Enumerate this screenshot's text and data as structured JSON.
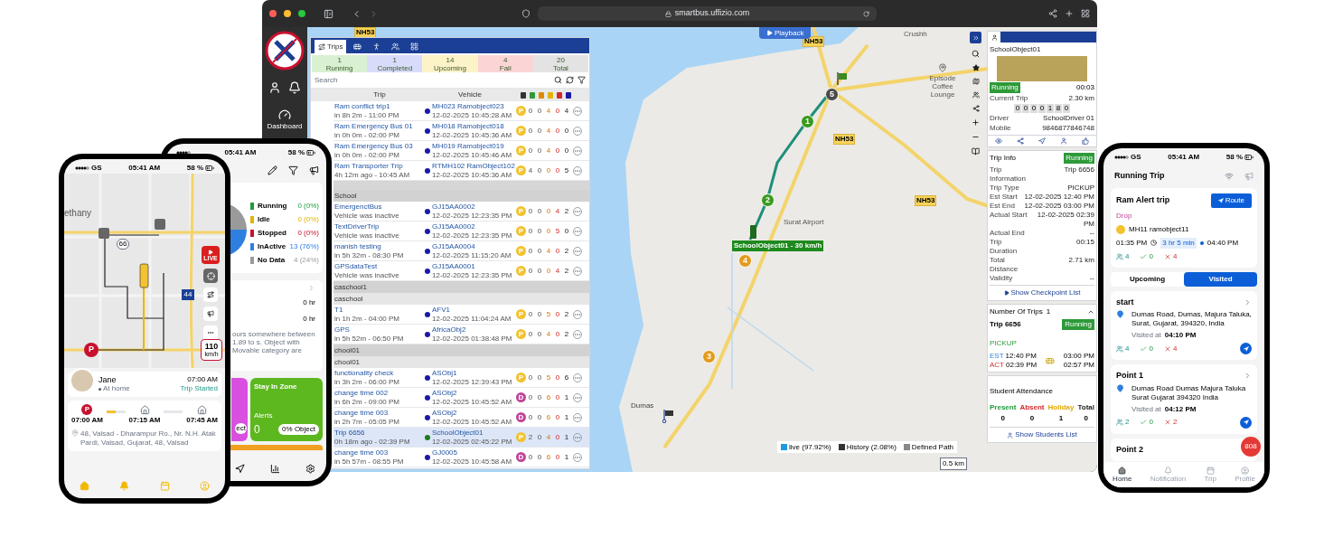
{
  "browser": {
    "url": "smartbus.uffizio.com",
    "sidebar": {
      "dashboard": "Dashboard"
    },
    "trips_panel": {
      "tabs": [
        {
          "label": "Trips",
          "selected": true
        },
        {
          "selected": false
        },
        {
          "selected": false
        },
        {
          "selected": false
        },
        {
          "selected": false
        }
      ],
      "summary": [
        {
          "count": "1",
          "label": "Running",
          "color": "#d9f0d3"
        },
        {
          "count": "1",
          "label": "Completed",
          "color": "#d8dcfa"
        },
        {
          "count": "14",
          "label": "Upcoming",
          "color": "#fdf3c8"
        },
        {
          "count": "4",
          "label": "Fail",
          "color": "#fbd5d5"
        },
        {
          "count": "20",
          "label": "Total",
          "color": "#e3e3e3"
        }
      ],
      "search": {
        "placeholder": "Search"
      },
      "columns": [
        "Trip",
        "Vehicle"
      ],
      "rows": [
        {
          "kind": "trip",
          "name": "Ram conflict trip1",
          "eta": "in 8h 2m - 11:00 PM",
          "vehicle": "MH023 Ramobject023",
          "time": "12-02-2025 10:45:28 AM",
          "dot": {
            "color": "#1a1aa6"
          },
          "badge": {
            "label": "P",
            "color": "#f2c230"
          },
          "counts": [
            "0",
            "0",
            "4",
            "0",
            "4"
          ],
          "selected": false
        },
        {
          "kind": "trip",
          "name": "Ram Emergency Bus 01",
          "eta": "in 0h 0m - 02:00 PM",
          "vehicle": "MH018 Ramobject018",
          "time": "12-02-2025 10:45:36 AM",
          "dot": {
            "color": "#1a1aa6"
          },
          "badge": {
            "label": "P",
            "color": "#f2c230"
          },
          "counts": [
            "0",
            "0",
            "4",
            "0",
            "0"
          ],
          "selected": false
        },
        {
          "kind": "trip",
          "name": "Ram Emergency Bus 03",
          "eta": "in 0h 0m - 02:00 PM",
          "vehicle": "MH019 Ramobject019",
          "time": "12-02-2025 10:45:46 AM",
          "dot": {
            "color": "#1a1aa6"
          },
          "badge": {
            "label": "P",
            "color": "#f2c230"
          },
          "counts": [
            "0",
            "0",
            "4",
            "0",
            "0"
          ],
          "selected": false
        },
        {
          "kind": "trip",
          "name": "Ram Transporter Trip",
          "eta": "4h 12m ago - 10:45 AM",
          "vehicle": "RTMH102 RamObject102",
          "time": "12-02-2025 10:45:36 AM",
          "dot": {
            "color": "#1a1aa6"
          },
          "badge": {
            "label": "P",
            "color": "#f2c230"
          },
          "counts": [
            "4",
            "0",
            "0",
            "0",
            "5"
          ],
          "selected": false
        },
        {
          "kind": "spacer"
        },
        {
          "kind": "group",
          "label": "School"
        },
        {
          "kind": "trip",
          "name": "EmergenctBus",
          "eta": "Vehicle was inactive",
          "vehicle": "GJ15AA0002",
          "time": "12-02-2025 12:23:35 PM",
          "dot": {
            "color": "#1a1aa6"
          },
          "badge": {
            "label": "P",
            "color": "#f2c230"
          },
          "counts": [
            "0",
            "0",
            "0",
            "4",
            "2"
          ],
          "selected": false
        },
        {
          "kind": "trip",
          "name": "TextDriverTrip",
          "eta": "Vehicle was inactive",
          "vehicle": "GJ15AA0002",
          "time": "12-02-2025 12:23:35 PM",
          "dot": {
            "color": "#1a1aa6"
          },
          "badge": {
            "label": "P",
            "color": "#f2c230"
          },
          "counts": [
            "0",
            "0",
            "0",
            "5",
            "0"
          ],
          "selected": false
        },
        {
          "kind": "trip",
          "name": "manish testing",
          "eta": "in 5h 32m - 08:30 PM",
          "vehicle": "GJ15AA0004",
          "time": "12-02-2025 11:15:20 AM",
          "dot": {
            "color": "#1a1aa6"
          },
          "badge": {
            "label": "P",
            "color": "#f2c230"
          },
          "counts": [
            "0",
            "0",
            "4",
            "0",
            "2"
          ],
          "selected": false
        },
        {
          "kind": "trip",
          "name": "GPSdataTest",
          "eta": "Vehicle was inactive",
          "vehicle": "GJ15AA0001",
          "time": "12-02-2025 12:23:35 PM",
          "dot": {
            "color": "#1a1aa6"
          },
          "badge": {
            "label": "P",
            "color": "#f2c230"
          },
          "counts": [
            "0",
            "0",
            "0",
            "4",
            "2"
          ],
          "selected": false
        },
        {
          "kind": "group",
          "label": "caschool1"
        },
        {
          "kind": "subgroup",
          "label": "caschool"
        },
        {
          "kind": "trip",
          "name": "T1",
          "eta": "in 1h 2m - 04:00 PM",
          "vehicle": "AFV1",
          "time": "12-02-2025 11:04:24 AM",
          "dot": {
            "color": "#1a1aa6"
          },
          "badge": {
            "label": "P",
            "color": "#f2c230"
          },
          "counts": [
            "0",
            "0",
            "5",
            "0",
            "2"
          ],
          "selected": false
        },
        {
          "kind": "trip",
          "name": "GPS",
          "eta": "in 5h 52m - 06:50 PM",
          "vehicle": "AfricaObj2",
          "time": "12-02-2025 01:38:48 PM",
          "dot": {
            "color": "#1a1aa6"
          },
          "badge": {
            "label": "P",
            "color": "#f2c230"
          },
          "counts": [
            "0",
            "0",
            "4",
            "0",
            "2"
          ],
          "selected": false
        },
        {
          "kind": "group",
          "label": "chool01"
        },
        {
          "kind": "subgroup",
          "label": "chool01"
        },
        {
          "kind": "trip",
          "name": "functionality check",
          "eta": "in 3h 2m - 06:00 PM",
          "vehicle": "ASObj1",
          "time": "12-02-2025 12:39:43 PM",
          "dot": {
            "color": "#1a1aa6"
          },
          "badge": {
            "label": "P",
            "color": "#f2c230"
          },
          "counts": [
            "0",
            "0",
            "5",
            "0",
            "6"
          ],
          "selected": false
        },
        {
          "kind": "trip",
          "name": "change time 002",
          "eta": "in 6h 2m - 09:00 PM",
          "vehicle": "ASObj2",
          "time": "12-02-2025 10:45:52 AM",
          "dot": {
            "color": "#1a1aa6"
          },
          "badge": {
            "label": "D",
            "color": "#c2469a"
          },
          "counts": [
            "0",
            "0",
            "6",
            "0",
            "1"
          ],
          "selected": false
        },
        {
          "kind": "trip",
          "name": "change time 003",
          "eta": "in 2h 7m - 05:05 PM",
          "vehicle": "ASObj2",
          "time": "12-02-2025 10:45:52 AM",
          "dot": {
            "color": "#1a1aa6"
          },
          "badge": {
            "label": "D",
            "color": "#c2469a"
          },
          "counts": [
            "0",
            "0",
            "6",
            "0",
            "1"
          ],
          "selected": false
        },
        {
          "kind": "trip",
          "name": "Trip 6656",
          "eta": "0h 18m ago - 02:39 PM",
          "vehicle": "SchoolObject01",
          "time": "12-02-2025 02:45:22 PM",
          "dot": {
            "color": "#1e7d1e"
          },
          "badge": {
            "label": "P",
            "color": "#f2c230"
          },
          "counts": [
            "2",
            "0",
            "4",
            "0",
            "1"
          ],
          "selected": true
        },
        {
          "kind": "trip",
          "name": "change time 003",
          "eta": "in 5h 57m - 08:55 PM",
          "vehicle": "GJ0005",
          "time": "12-02-2025 10:45:58 AM",
          "dot": {
            "color": "#1a1aa6"
          },
          "badge": {
            "label": "D",
            "color": "#c2469a"
          },
          "counts": [
            "0",
            "0",
            "6",
            "0",
            "1"
          ],
          "selected": false
        }
      ]
    },
    "map": {
      "playback": "Playback",
      "roads": [
        "NH53",
        "NH53",
        "NH53",
        "NH53"
      ],
      "places": [
        "Crushh",
        "Episode Coffee Lounge",
        "Surat Airport",
        "Dumas"
      ],
      "stops": [
        {
          "label": "5",
          "color": "#4a4a4a"
        },
        {
          "label": "1",
          "color": "#3a9a1e"
        },
        {
          "label": "2",
          "color": "#3a9a1e"
        },
        {
          "label": "4",
          "color": "#e39a1c"
        },
        {
          "label": "3",
          "color": "#e39a1c"
        }
      ],
      "vehicle_label": "SchoolObject01 - 30 km/h",
      "legend": [
        {
          "label": "live (97.92%)",
          "color": "#1e9be0"
        },
        {
          "label": "History (2.08%)",
          "color": "#333333"
        },
        {
          "label": "Defined Path",
          "color": "#888888"
        }
      ],
      "scale": "0.5 km"
    },
    "object_panel": {
      "name": "SchoolObject01",
      "status": "Running",
      "duration": "00:03",
      "current_trip_label": "Current Trip",
      "current_trip": "2.30 km",
      "odometer": [
        "0",
        "0",
        "0",
        "0",
        "1",
        "8",
        "0"
      ],
      "fields": [
        {
          "label": "Driver",
          "value": "SchoolDriver 01"
        },
        {
          "label": "Mobile",
          "value": "9846877846748"
        }
      ]
    },
    "trip_info": {
      "title": "Trip Info",
      "status": "Running",
      "fields": [
        {
          "label": "Trip Information",
          "value": "Trip 6656"
        },
        {
          "label": "Trip Type",
          "value": "PICKUP"
        },
        {
          "label": "Est Start",
          "value": "12-02-2025 12:40 PM"
        },
        {
          "label": "Est End",
          "value": "12-02-2025 03:00 PM"
        },
        {
          "label": "Actual Start",
          "value": "12-02-2025 02:39 PM"
        },
        {
          "label": "Actual End",
          "value": "--"
        },
        {
          "label": "Trip Duration",
          "value": "00:15"
        },
        {
          "label": "Total Distance",
          "value": "2.71 km"
        },
        {
          "label": "Validity",
          "value": "--"
        }
      ],
      "action": "Show Checkpoint List"
    },
    "trips_count": {
      "title": "Number Of Trips",
      "count": "1",
      "trip": "Trip 6656",
      "type": "PICKUP",
      "status": "Running",
      "est_label": "EST",
      "est_start": "12:40 PM",
      "est_end": "03:00 PM",
      "act_label": "ACT",
      "act_start": "02:39 PM",
      "act_end": "02:57 PM"
    },
    "attendance": {
      "title": "Student Attendance",
      "items": [
        {
          "label": "Present",
          "value": "0",
          "color": "#1e9a3a"
        },
        {
          "label": "Absent",
          "value": "0",
          "color": "#d02a2a"
        },
        {
          "label": "Holiday",
          "value": "1",
          "color": "#e0a800"
        },
        {
          "label": "Total",
          "value": "0",
          "color": "#222222"
        }
      ],
      "action": "Show Students List"
    }
  },
  "dashboard_phone": {
    "time": "05:41 AM",
    "battery": "58 %",
    "legend": [
      {
        "label": "Running",
        "value": "0 (0%)",
        "color": "#1e9a3a"
      },
      {
        "label": "Idle",
        "value": "0 (0%)",
        "color": "#e0b400"
      },
      {
        "label": "Stopped",
        "value": "0 (0%)",
        "color": "#c8102e"
      },
      {
        "label": "InActive",
        "value": "13 (76%)",
        "color": "#2f7fe0"
      },
      {
        "label": "No Data",
        "value": "4 (24%)",
        "color": "#9a9a9a"
      }
    ],
    "hours": [
      "0 hr",
      "0 hr"
    ],
    "note_lines": [
      "ours somewhere between 1.89 to",
      "s. Object with Movable category are"
    ],
    "tiles": [
      {
        "kind": "pink",
        "button": "ect"
      },
      {
        "kind": "green",
        "title": "Stay In Zone",
        "caption": "Alerts",
        "value": "0",
        "button": "0% Object"
      }
    ]
  },
  "parent_phone": {
    "carrier": "GS",
    "parking": "P",
    "time": "05:41 AM",
    "battery": "58 %",
    "place": "ethany",
    "shields": [
      "66",
      "44"
    ],
    "live": "LIVE",
    "speed": "110",
    "speed_unit": "km/h",
    "child": {
      "name": "Jane",
      "status": "At home",
      "time": "07:00 AM",
      "trip_status": "Trip Started"
    },
    "timeline": [
      {
        "marker": "P",
        "time": "07:00 AM",
        "level": 0.5
      },
      {
        "time": "07:15 AM",
        "level": 0
      },
      {
        "time": "07:45 AM"
      }
    ],
    "address": "48, Valsad - Dharampur Ro., Nr. N.H. Atak Pardi, Valsad, Gujarat, 48, Valsad"
  },
  "driver_phone": {
    "carrier": "GS",
    "time": "05:41 AM",
    "battery": "58 %",
    "title": "Running Trip",
    "trip": {
      "name": "Route",
      "title": "Ram Alert trip",
      "type": "Drop",
      "vehicle": "MH11 ramobject11",
      "start": "01:35 PM",
      "duration": "3 hr 5 min",
      "end": "04:40 PM",
      "counts": [
        "4",
        "0",
        "4"
      ]
    },
    "tabs": [
      {
        "label": "Upcoming",
        "selected": false
      },
      {
        "label": "Visited",
        "selected": true
      }
    ],
    "points": [
      {
        "name": "start",
        "address": "Dumas Road, Dumas, Majura Taluka, Surat, Gujarat, 394320, India",
        "visited_label": "Visited at",
        "visited": "04:10 PM",
        "counts": [
          "4",
          "0",
          "4"
        ]
      },
      {
        "name": "Point 1",
        "address": "Dumas Road Dumas Majura Taluka Surat Gujarat 394320 India",
        "visited_label": "Visited at",
        "visited": "04:12 PM",
        "counts": [
          "2",
          "0",
          "2"
        ]
      },
      {
        "name": "Point 2"
      }
    ],
    "fab": "808",
    "nav": [
      {
        "label": "Home",
        "selected": true
      },
      {
        "label": "Notification",
        "selected": false
      },
      {
        "label": "Trip",
        "selected": false
      },
      {
        "label": "Profile",
        "selected": false
      }
    ]
  }
}
